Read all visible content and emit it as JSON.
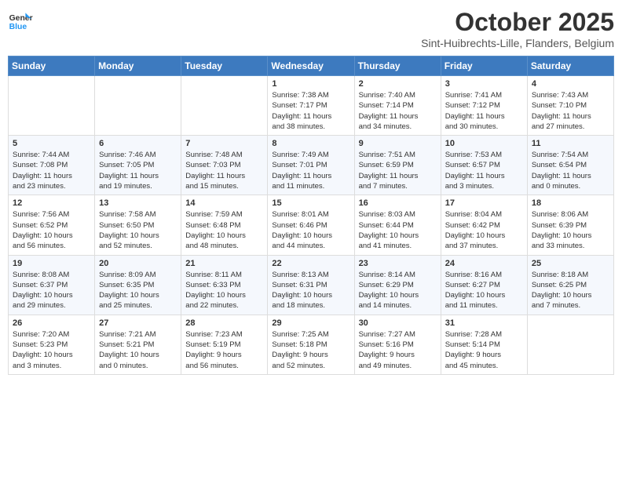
{
  "header": {
    "logo_line1": "General",
    "logo_line2": "Blue",
    "title": "October 2025",
    "subtitle": "Sint-Huibrechts-Lille, Flanders, Belgium"
  },
  "weekdays": [
    "Sunday",
    "Monday",
    "Tuesday",
    "Wednesday",
    "Thursday",
    "Friday",
    "Saturday"
  ],
  "weeks": [
    [
      {
        "day": "",
        "info": ""
      },
      {
        "day": "",
        "info": ""
      },
      {
        "day": "",
        "info": ""
      },
      {
        "day": "1",
        "info": "Sunrise: 7:38 AM\nSunset: 7:17 PM\nDaylight: 11 hours\nand 38 minutes."
      },
      {
        "day": "2",
        "info": "Sunrise: 7:40 AM\nSunset: 7:14 PM\nDaylight: 11 hours\nand 34 minutes."
      },
      {
        "day": "3",
        "info": "Sunrise: 7:41 AM\nSunset: 7:12 PM\nDaylight: 11 hours\nand 30 minutes."
      },
      {
        "day": "4",
        "info": "Sunrise: 7:43 AM\nSunset: 7:10 PM\nDaylight: 11 hours\nand 27 minutes."
      }
    ],
    [
      {
        "day": "5",
        "info": "Sunrise: 7:44 AM\nSunset: 7:08 PM\nDaylight: 11 hours\nand 23 minutes."
      },
      {
        "day": "6",
        "info": "Sunrise: 7:46 AM\nSunset: 7:05 PM\nDaylight: 11 hours\nand 19 minutes."
      },
      {
        "day": "7",
        "info": "Sunrise: 7:48 AM\nSunset: 7:03 PM\nDaylight: 11 hours\nand 15 minutes."
      },
      {
        "day": "8",
        "info": "Sunrise: 7:49 AM\nSunset: 7:01 PM\nDaylight: 11 hours\nand 11 minutes."
      },
      {
        "day": "9",
        "info": "Sunrise: 7:51 AM\nSunset: 6:59 PM\nDaylight: 11 hours\nand 7 minutes."
      },
      {
        "day": "10",
        "info": "Sunrise: 7:53 AM\nSunset: 6:57 PM\nDaylight: 11 hours\nand 3 minutes."
      },
      {
        "day": "11",
        "info": "Sunrise: 7:54 AM\nSunset: 6:54 PM\nDaylight: 11 hours\nand 0 minutes."
      }
    ],
    [
      {
        "day": "12",
        "info": "Sunrise: 7:56 AM\nSunset: 6:52 PM\nDaylight: 10 hours\nand 56 minutes."
      },
      {
        "day": "13",
        "info": "Sunrise: 7:58 AM\nSunset: 6:50 PM\nDaylight: 10 hours\nand 52 minutes."
      },
      {
        "day": "14",
        "info": "Sunrise: 7:59 AM\nSunset: 6:48 PM\nDaylight: 10 hours\nand 48 minutes."
      },
      {
        "day": "15",
        "info": "Sunrise: 8:01 AM\nSunset: 6:46 PM\nDaylight: 10 hours\nand 44 minutes."
      },
      {
        "day": "16",
        "info": "Sunrise: 8:03 AM\nSunset: 6:44 PM\nDaylight: 10 hours\nand 41 minutes."
      },
      {
        "day": "17",
        "info": "Sunrise: 8:04 AM\nSunset: 6:42 PM\nDaylight: 10 hours\nand 37 minutes."
      },
      {
        "day": "18",
        "info": "Sunrise: 8:06 AM\nSunset: 6:39 PM\nDaylight: 10 hours\nand 33 minutes."
      }
    ],
    [
      {
        "day": "19",
        "info": "Sunrise: 8:08 AM\nSunset: 6:37 PM\nDaylight: 10 hours\nand 29 minutes."
      },
      {
        "day": "20",
        "info": "Sunrise: 8:09 AM\nSunset: 6:35 PM\nDaylight: 10 hours\nand 25 minutes."
      },
      {
        "day": "21",
        "info": "Sunrise: 8:11 AM\nSunset: 6:33 PM\nDaylight: 10 hours\nand 22 minutes."
      },
      {
        "day": "22",
        "info": "Sunrise: 8:13 AM\nSunset: 6:31 PM\nDaylight: 10 hours\nand 18 minutes."
      },
      {
        "day": "23",
        "info": "Sunrise: 8:14 AM\nSunset: 6:29 PM\nDaylight: 10 hours\nand 14 minutes."
      },
      {
        "day": "24",
        "info": "Sunrise: 8:16 AM\nSunset: 6:27 PM\nDaylight: 10 hours\nand 11 minutes."
      },
      {
        "day": "25",
        "info": "Sunrise: 8:18 AM\nSunset: 6:25 PM\nDaylight: 10 hours\nand 7 minutes."
      }
    ],
    [
      {
        "day": "26",
        "info": "Sunrise: 7:20 AM\nSunset: 5:23 PM\nDaylight: 10 hours\nand 3 minutes."
      },
      {
        "day": "27",
        "info": "Sunrise: 7:21 AM\nSunset: 5:21 PM\nDaylight: 10 hours\nand 0 minutes."
      },
      {
        "day": "28",
        "info": "Sunrise: 7:23 AM\nSunset: 5:19 PM\nDaylight: 9 hours\nand 56 minutes."
      },
      {
        "day": "29",
        "info": "Sunrise: 7:25 AM\nSunset: 5:18 PM\nDaylight: 9 hours\nand 52 minutes."
      },
      {
        "day": "30",
        "info": "Sunrise: 7:27 AM\nSunset: 5:16 PM\nDaylight: 9 hours\nand 49 minutes."
      },
      {
        "day": "31",
        "info": "Sunrise: 7:28 AM\nSunset: 5:14 PM\nDaylight: 9 hours\nand 45 minutes."
      },
      {
        "day": "",
        "info": ""
      }
    ]
  ]
}
